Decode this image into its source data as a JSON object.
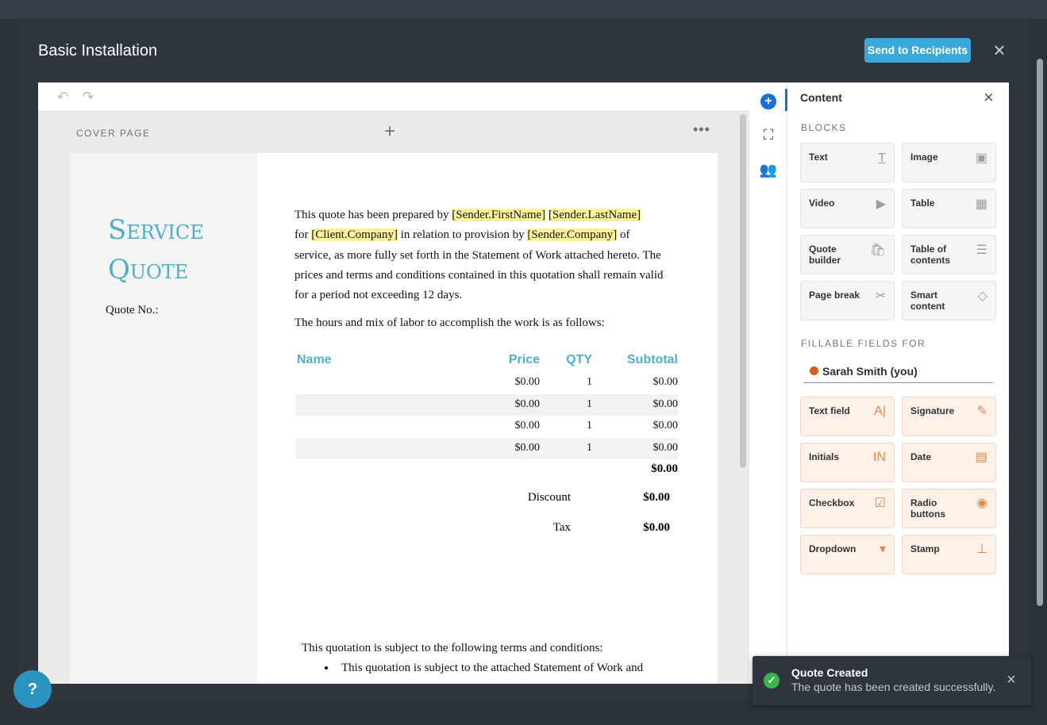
{
  "modal": {
    "title": "Basic Installation",
    "send_label": "Send to Recipients",
    "close_glyph": "×"
  },
  "toolbar": {
    "undo_glyph": "↶",
    "redo_glyph": "↷"
  },
  "page": {
    "label": "COVER PAGE",
    "add_glyph": "+",
    "more_glyph": "•••"
  },
  "cover": {
    "title_line1": "Service",
    "title_line2": "Quote",
    "quote_no_label": "Quote No.:"
  },
  "body": {
    "p1_a": "This quote has been prepared by ",
    "tok_sender_first": "[Sender.FirstName]",
    "tok_sender_last": "[Sender.LastName]",
    "p1_b": "for ",
    "tok_client_company": "[Client.Company]",
    "p1_c": " in relation to provision by ",
    "tok_sender_company": "[Sender.Company]",
    "p1_d": " of service, as more fully set forth in the Statement of Work attached hereto. The prices and terms and conditions contained in this quotation shall remain valid for a period not exceeding 12 days.",
    "p2": "The hours and mix of labor to accomplish the work is as follows:"
  },
  "quote_table": {
    "headers": {
      "name": "Name",
      "price": "Price",
      "qty": "QTY",
      "subtotal": "Subtotal"
    },
    "rows": [
      {
        "name": "",
        "price": "$0.00",
        "qty": "1",
        "subtotal": "$0.00"
      },
      {
        "name": "",
        "price": "$0.00",
        "qty": "1",
        "subtotal": "$0.00"
      },
      {
        "name": "",
        "price": "$0.00",
        "qty": "1",
        "subtotal": "$0.00"
      },
      {
        "name": "",
        "price": "$0.00",
        "qty": "1",
        "subtotal": "$0.00"
      }
    ],
    "total": "$0.00",
    "discount_label": "Discount",
    "discount_value": "$0.00",
    "tax_label": "Tax",
    "tax_value": "$0.00"
  },
  "terms": {
    "intro": "This quotation is subject to the following terms and conditions:",
    "bullet1": "This quotation is subject to the attached Statement of Work and"
  },
  "panel": {
    "title": "Content",
    "close_glyph": "×",
    "blocks_label": "BLOCKS",
    "blocks": [
      {
        "label": "Text",
        "icon": "T̲",
        "icon_name": "text-icon"
      },
      {
        "label": "Image",
        "icon": "▣",
        "icon_name": "image-icon"
      },
      {
        "label": "Video",
        "icon": "▶",
        "icon_name": "video-icon"
      },
      {
        "label": "Table",
        "icon": "▦",
        "icon_name": "table-icon"
      },
      {
        "label": "Quote builder",
        "icon": "🛍",
        "icon_name": "quote-builder-icon"
      },
      {
        "label": "Table of contents",
        "icon": "☰",
        "icon_name": "toc-icon"
      },
      {
        "label": "Page break",
        "icon": "✂",
        "icon_name": "page-break-icon"
      },
      {
        "label": "Smart content",
        "icon": "◇",
        "icon_name": "smart-content-icon"
      }
    ],
    "fields_label": "FILLABLE FIELDS FOR",
    "recipient": "Sarah Smith (you)",
    "fields": [
      {
        "label": "Text field",
        "icon": "A|",
        "icon_name": "text-field-icon"
      },
      {
        "label": "Signature",
        "icon": "✎",
        "icon_name": "signature-icon"
      },
      {
        "label": "Initials",
        "icon": "IN",
        "icon_name": "initials-icon"
      },
      {
        "label": "Date",
        "icon": "▤",
        "icon_name": "calendar-icon"
      },
      {
        "label": "Checkbox",
        "icon": "☑",
        "icon_name": "checkbox-icon"
      },
      {
        "label": "Radio buttons",
        "icon": "◉",
        "icon_name": "radio-icon"
      },
      {
        "label": "Dropdown",
        "icon": "▾",
        "icon_name": "dropdown-icon"
      },
      {
        "label": "Stamp",
        "icon": "⊥",
        "icon_name": "stamp-icon"
      }
    ]
  },
  "side_tabs": {
    "add_glyph": "+",
    "frame_glyph": "⛶",
    "people_glyph": "👥"
  },
  "help": {
    "glyph": "?"
  },
  "toast": {
    "title": "Quote Created",
    "message": "The quote has been created successfully.",
    "check_glyph": "✓",
    "close_glyph": "×"
  },
  "colors": {
    "accent": "#3aa8d8",
    "title_teal": "#4db0c8",
    "highlight": "#fff39a",
    "field_accent": "#e0884f"
  }
}
